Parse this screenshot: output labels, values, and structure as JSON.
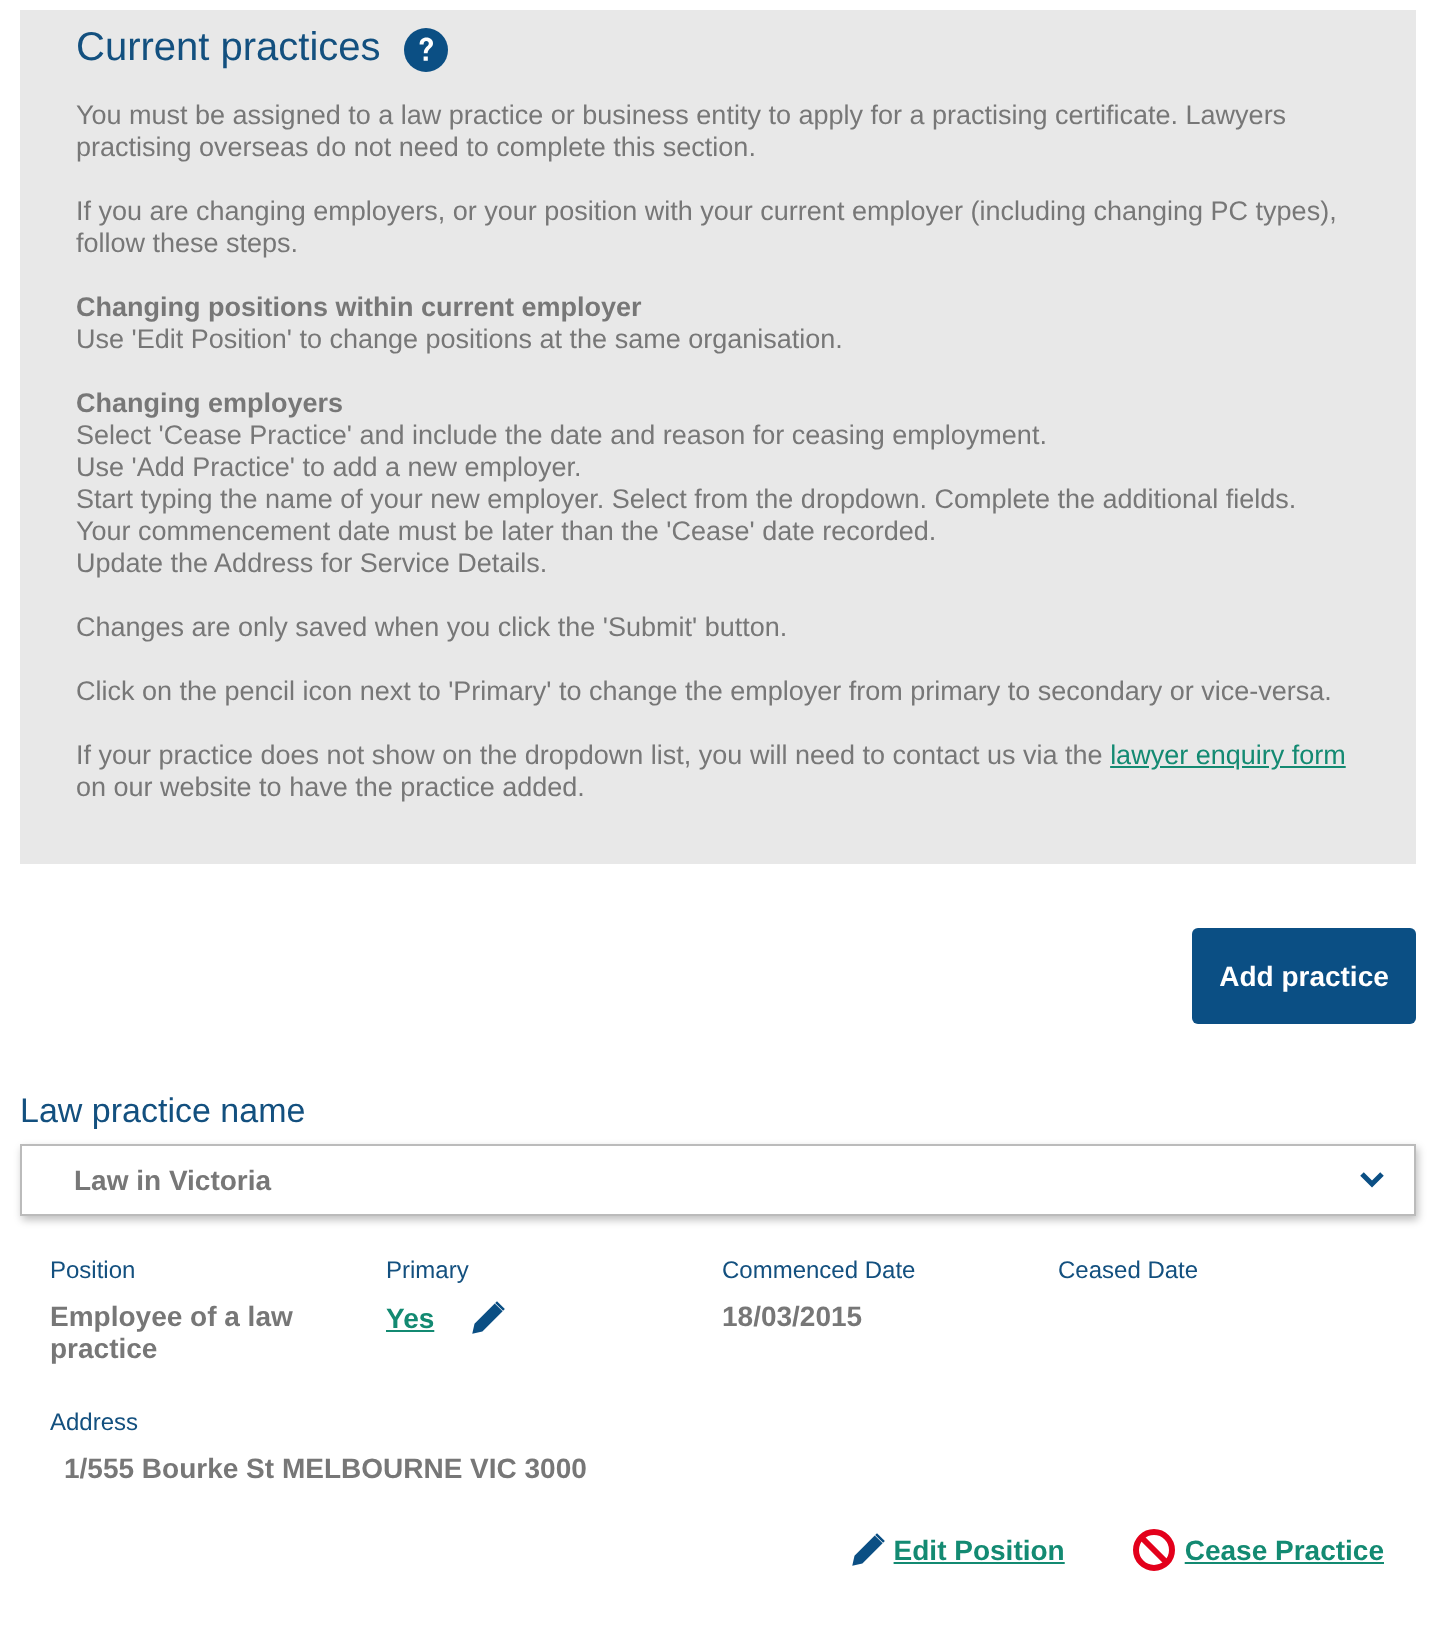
{
  "info": {
    "title": "Current practices",
    "blocks": [
      {
        "lines": [
          "You must be assigned to a law practice or business entity to apply for a practising certificate. Lawyers practising overseas do not need to complete this section."
        ]
      },
      {
        "lines": [
          "If you are changing employers, or your position with your current employer (including changing PC types), follow these steps."
        ]
      },
      {
        "heading": "Changing positions within current employer",
        "lines": [
          "Use 'Edit Position' to change positions at the same organisation."
        ]
      },
      {
        "heading": "Changing employers",
        "lines": [
          "Select 'Cease Practice' and include the date and reason for ceasing employment.",
          "Use 'Add Practice' to add a new employer.",
          "Start typing the name of your new employer. Select from the dropdown. Complete the additional fields.",
          "Your commencement date must be later than the 'Cease' date recorded.",
          "Update the Address for Service Details."
        ]
      },
      {
        "lines": [
          "Changes are only saved when you click the 'Submit' button."
        ]
      },
      {
        "lines": [
          "Click on the pencil icon next to 'Primary' to change the employer from primary to secondary or vice-versa."
        ]
      },
      {
        "text": "If your practice does not show on the dropdown list, you will need to contact us via the",
        "link": "lawyer enquiry form",
        "text_after": "on our website to have the practice added."
      }
    ]
  },
  "add_button": "Add practice",
  "practice": {
    "label": "Law practice name",
    "value": "Law in Victoria",
    "fields": [
      {
        "label": "Position",
        "value": "Employee of a law practice",
        "kind": "text"
      },
      {
        "label": "Primary",
        "value": "Yes",
        "kind": "link"
      },
      {
        "label": "Commenced Date",
        "value": "18/03/2015",
        "kind": "text"
      },
      {
        "label": "Ceased Date",
        "kind": "empty"
      }
    ],
    "address_label": "Address",
    "address": "1/555 Bourke St MELBOURNE VIC 3000",
    "actions": [
      {
        "label": "Edit Position",
        "kind": "edit"
      },
      {
        "label": "Cease Practice",
        "kind": "cease"
      }
    ]
  }
}
